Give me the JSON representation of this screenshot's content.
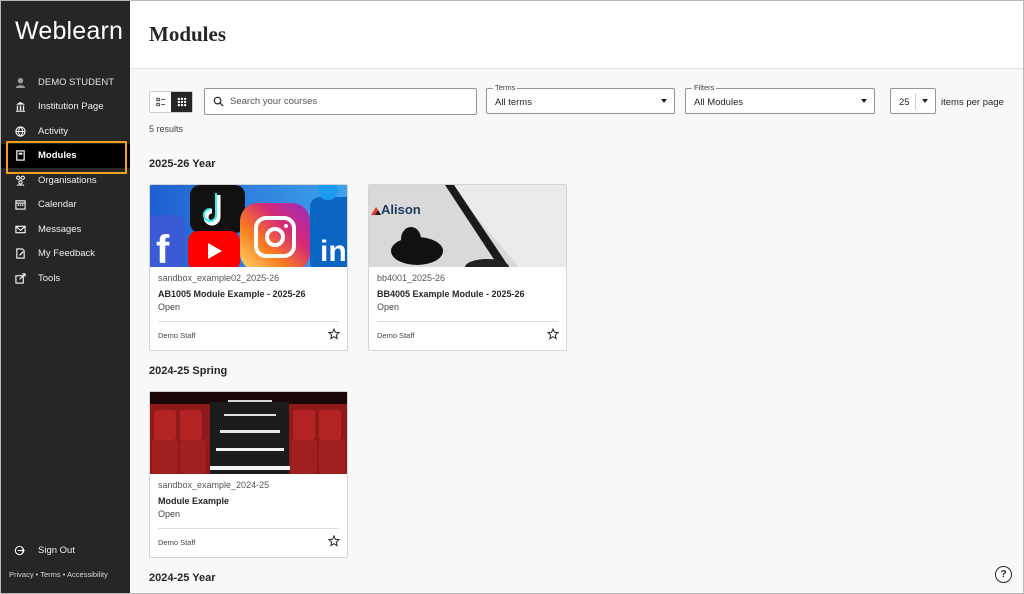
{
  "sidebar": {
    "brand": "Weblearn",
    "user_name": "DEMO STUDENT",
    "items": [
      {
        "label": "Institution Page",
        "icon": "institution-icon"
      },
      {
        "label": "Activity",
        "icon": "globe-icon"
      },
      {
        "label": "Modules",
        "icon": "book-icon"
      },
      {
        "label": "Organisations",
        "icon": "people-icon"
      },
      {
        "label": "Calendar",
        "icon": "calendar-icon"
      },
      {
        "label": "Messages",
        "icon": "envelope-icon"
      },
      {
        "label": "My Feedback",
        "icon": "feedback-icon"
      },
      {
        "label": "Tools",
        "icon": "tools-icon"
      }
    ],
    "active_item": "Modules",
    "sign_out": "Sign Out",
    "footer": "Privacy • Terms • Accessibility"
  },
  "header": {
    "title": "Modules"
  },
  "toolbar": {
    "search_placeholder": "Search your courses",
    "terms_label": "Terms",
    "terms_value": "All terms",
    "filters_label": "Filters",
    "filters_value": "All Modules",
    "items_per_page_value": "25",
    "items_per_page_label": "items per page"
  },
  "results_text": "5 results",
  "sections": [
    {
      "title": "2025-26 Year",
      "cards": [
        {
          "code": "sandbox_example02_2025-26",
          "name": "AB1005 Module Example - 2025-26",
          "status": "Open",
          "instructor": "Demo Staff",
          "image": "social-media-apps"
        },
        {
          "code": "bb4001_2025-26",
          "name": "BB4005 Example Module - 2025-26",
          "status": "Open",
          "instructor": "Demo Staff",
          "image": "alison-phone"
        }
      ]
    },
    {
      "title": "2024-25 Spring",
      "cards": [
        {
          "code": "sandbox_example_2024-25",
          "name": "Module Example",
          "status": "Open",
          "instructor": "Demo Staff",
          "image": "theatre-seats"
        }
      ]
    },
    {
      "title": "2024-25 Year",
      "cards": []
    }
  ],
  "image_text": {
    "alison_brand": "Alison"
  },
  "help_glyph": "?",
  "colors": {
    "sidebar_bg": "#262626",
    "active_highlight": "#f2a01c",
    "page_bg": "#f8f8f8"
  }
}
